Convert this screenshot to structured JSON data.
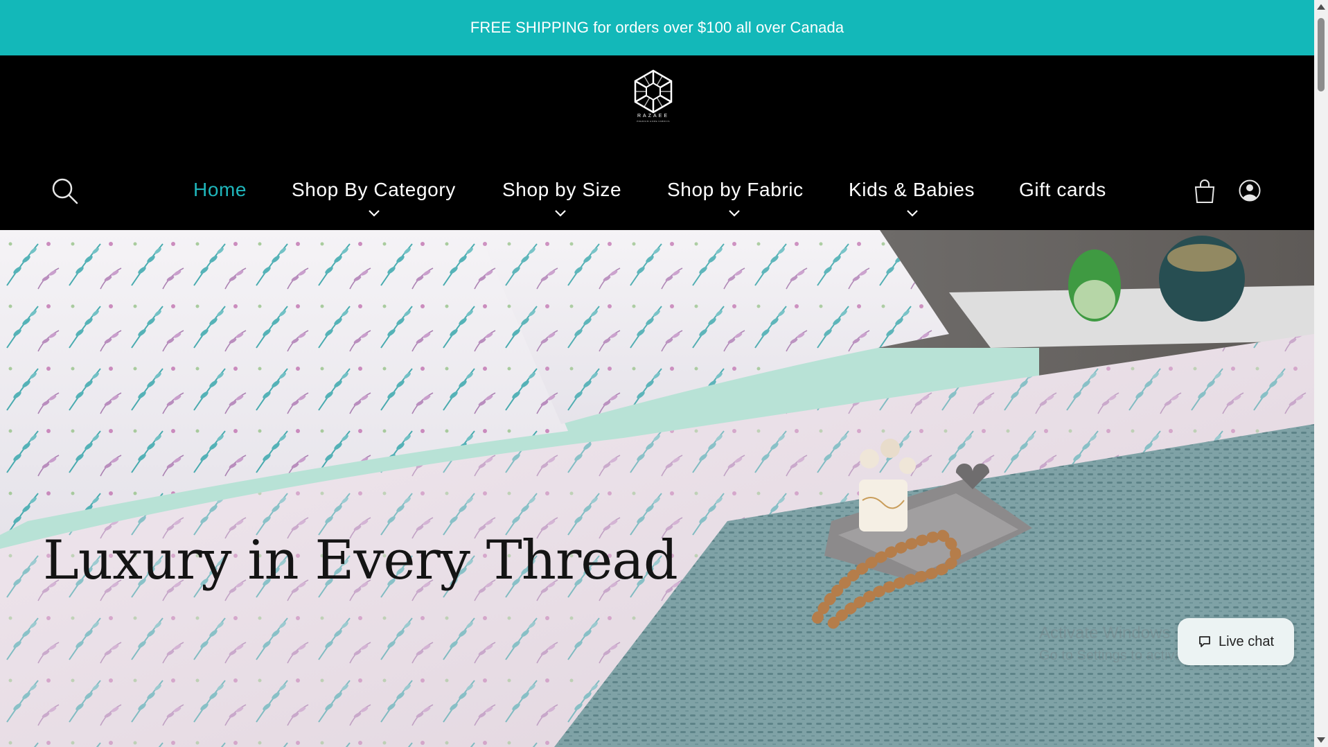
{
  "announcement": {
    "text": "FREE SHIPPING for orders over $100 all over Canada"
  },
  "brand": {
    "name": "RAZAEE",
    "tagline": "PREMIUM HOME FABRICS"
  },
  "nav": {
    "items": [
      {
        "label": "Home",
        "active": true,
        "has_dropdown": false
      },
      {
        "label": "Shop By Category",
        "active": false,
        "has_dropdown": true
      },
      {
        "label": "Shop by Size",
        "active": false,
        "has_dropdown": true
      },
      {
        "label": "Shop by Fabric",
        "active": false,
        "has_dropdown": true
      },
      {
        "label": "Kids & Babies",
        "active": false,
        "has_dropdown": true
      },
      {
        "label": "Gift cards",
        "active": false,
        "has_dropdown": false
      }
    ]
  },
  "icons": {
    "search": "search-icon",
    "cart": "cart-icon",
    "account": "account-icon",
    "chat": "chat-bubble-icon"
  },
  "hero": {
    "title": "Luxury in Every Thread"
  },
  "live_chat": {
    "label": "Live chat"
  },
  "os_watermark": {
    "line1": "Activate Windows",
    "line2": "Go to Settings to activate Windows."
  },
  "colors": {
    "accent": "#13b8b9",
    "header_bg": "#000000",
    "nav_active": "#1fb6bb"
  }
}
